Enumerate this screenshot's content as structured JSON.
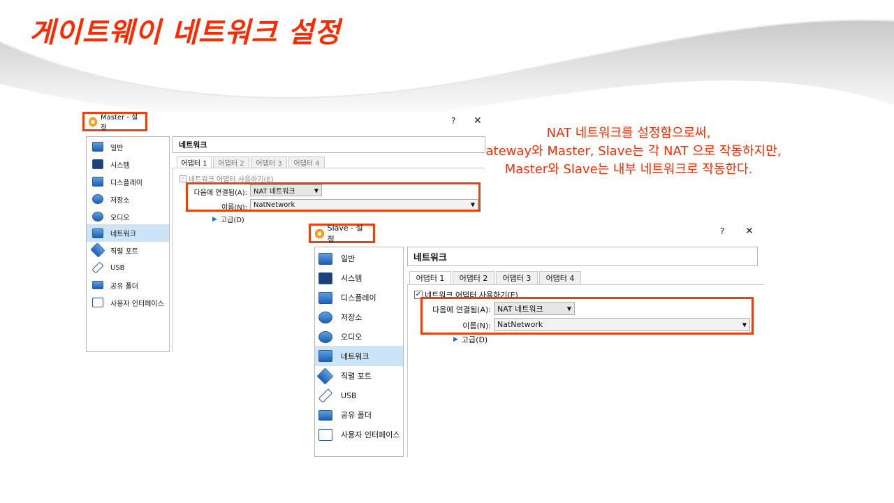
{
  "slide": {
    "title": "게이트웨이 네트워크 설정",
    "note_lines": [
      "NAT 네트워크를 설정함으로써,",
      "Gateway와 Master, Slave는 각 NAT 으로 작동하지만,",
      "Master와 Slave는 내부 네트워크로 작동한다."
    ],
    "accent_color": "#ff2a00"
  },
  "master": {
    "window_title": "Master - 설정",
    "help_label": "?",
    "close_label": "✕",
    "sidebar": [
      {
        "label": "일반",
        "icon": "general-icon"
      },
      {
        "label": "시스템",
        "icon": "system-icon"
      },
      {
        "label": "디스플레이",
        "icon": "display-icon"
      },
      {
        "label": "저장소",
        "icon": "storage-icon"
      },
      {
        "label": "오디오",
        "icon": "audio-icon"
      },
      {
        "label": "네트워크",
        "icon": "network-icon",
        "selected": true
      },
      {
        "label": "직렬 포트",
        "icon": "serial-port-icon"
      },
      {
        "label": "USB",
        "icon": "usb-icon"
      },
      {
        "label": "공유 폴더",
        "icon": "shared-folder-icon"
      },
      {
        "label": "사용자 인터페이스",
        "icon": "user-interface-icon"
      }
    ],
    "section_title": "네트워크",
    "tabs": [
      "어댑터 1",
      "어댑터 2",
      "어댑터 3",
      "어댑터 4"
    ],
    "enable_label": "네트워크 어댑터 사용하기(E)",
    "attached_label": "다음에 연결됨(A):",
    "attached_value": "NAT 네트워크",
    "name_label": "이름(N):",
    "name_value": "NatNetwork",
    "advanced_label": "고급(D)"
  },
  "slave": {
    "window_title": "Slave - 설정",
    "help_label": "?",
    "close_label": "✕",
    "sidebar": [
      {
        "label": "일반",
        "icon": "general-icon"
      },
      {
        "label": "시스템",
        "icon": "system-icon"
      },
      {
        "label": "디스플레이",
        "icon": "display-icon"
      },
      {
        "label": "저장소",
        "icon": "storage-icon"
      },
      {
        "label": "오디오",
        "icon": "audio-icon"
      },
      {
        "label": "네트워크",
        "icon": "network-icon",
        "selected": true
      },
      {
        "label": "직렬 포트",
        "icon": "serial-port-icon"
      },
      {
        "label": "USB",
        "icon": "usb-icon"
      },
      {
        "label": "공유 폴더",
        "icon": "shared-folder-icon"
      },
      {
        "label": "사용자 인터페이스",
        "icon": "user-interface-icon"
      }
    ],
    "section_title": "네트워크",
    "tabs": [
      "어댑터 1",
      "어댑터 2",
      "어댑터 3",
      "어댑터 4"
    ],
    "enable_label": "네트워크 어댑터 사용하기(E)",
    "attached_label": "다음에 연결됨(A):",
    "attached_value": "NAT 네트워크",
    "name_label": "이름(N):",
    "name_value": "NatNetwork",
    "advanced_label": "고급(D)"
  }
}
